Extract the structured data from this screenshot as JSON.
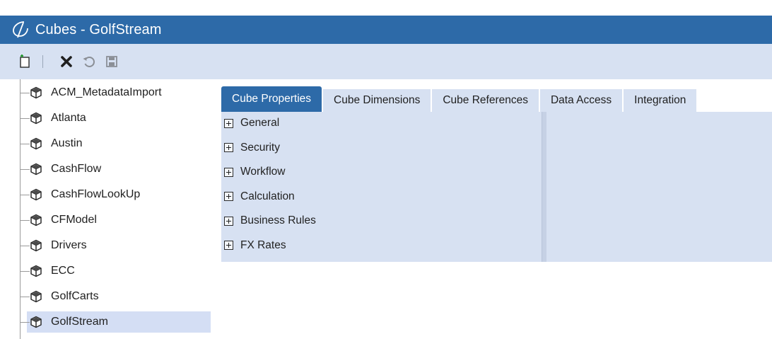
{
  "window": {
    "title": "Cubes - GolfStream"
  },
  "toolbar": {
    "buttons": [
      "new-icon",
      "delete-icon",
      "revert-icon",
      "save-icon"
    ]
  },
  "sidebar": {
    "items": [
      {
        "label": "ACM_MetadataImport"
      },
      {
        "label": "Atlanta"
      },
      {
        "label": "Austin"
      },
      {
        "label": "CashFlow"
      },
      {
        "label": "CashFlowLookUp"
      },
      {
        "label": "CFModel"
      },
      {
        "label": "Drivers"
      },
      {
        "label": "ECC"
      },
      {
        "label": "GolfCarts"
      },
      {
        "label": "GolfStream"
      }
    ],
    "selected": "GolfStream"
  },
  "tabs": [
    {
      "label": "Cube Properties"
    },
    {
      "label": "Cube Dimensions"
    },
    {
      "label": "Cube References"
    },
    {
      "label": "Data Access"
    },
    {
      "label": "Integration"
    }
  ],
  "properties": {
    "sections": [
      {
        "label": "General"
      },
      {
        "label": "Security"
      },
      {
        "label": "Workflow"
      },
      {
        "label": "Calculation"
      },
      {
        "label": "Business Rules"
      },
      {
        "label": "FX Rates"
      }
    ]
  },
  "colors": {
    "accent": "#2d6aa8",
    "panel": "#d7e1f2",
    "selected": "#d4def4"
  }
}
